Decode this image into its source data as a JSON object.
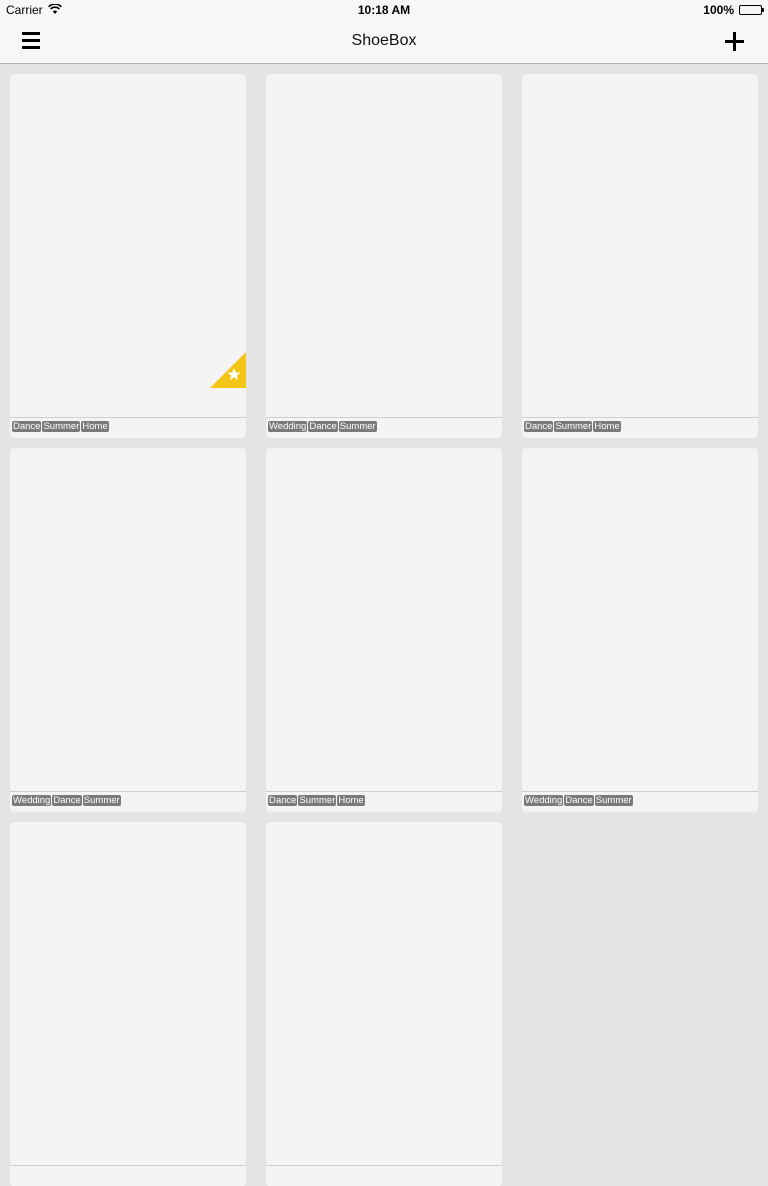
{
  "status_bar": {
    "carrier": "Carrier",
    "time": "10:18 AM",
    "battery": "100%"
  },
  "nav": {
    "title": "ShoeBox"
  },
  "cards": [
    {
      "tags": [
        "Dance",
        "Summer",
        "Home"
      ],
      "favorite": true
    },
    {
      "tags": [
        "Wedding",
        "Dance",
        "Summer"
      ],
      "favorite": false
    },
    {
      "tags": [
        "Dance",
        "Summer",
        "Home"
      ],
      "favorite": false
    },
    {
      "tags": [
        "Wedding",
        "Dance",
        "Summer"
      ],
      "favorite": false
    },
    {
      "tags": [
        "Dance",
        "Summer",
        "Home"
      ],
      "favorite": false
    },
    {
      "tags": [
        "Wedding",
        "Dance",
        "Summer"
      ],
      "favorite": false
    },
    {
      "tags": [],
      "favorite": false
    },
    {
      "tags": [],
      "favorite": false
    }
  ],
  "colors": {
    "favorite_badge": "#f5c518",
    "tag_bg": "#7a7a7a",
    "card_bg": "#f4f4f4",
    "background": "#e5e5e5"
  }
}
